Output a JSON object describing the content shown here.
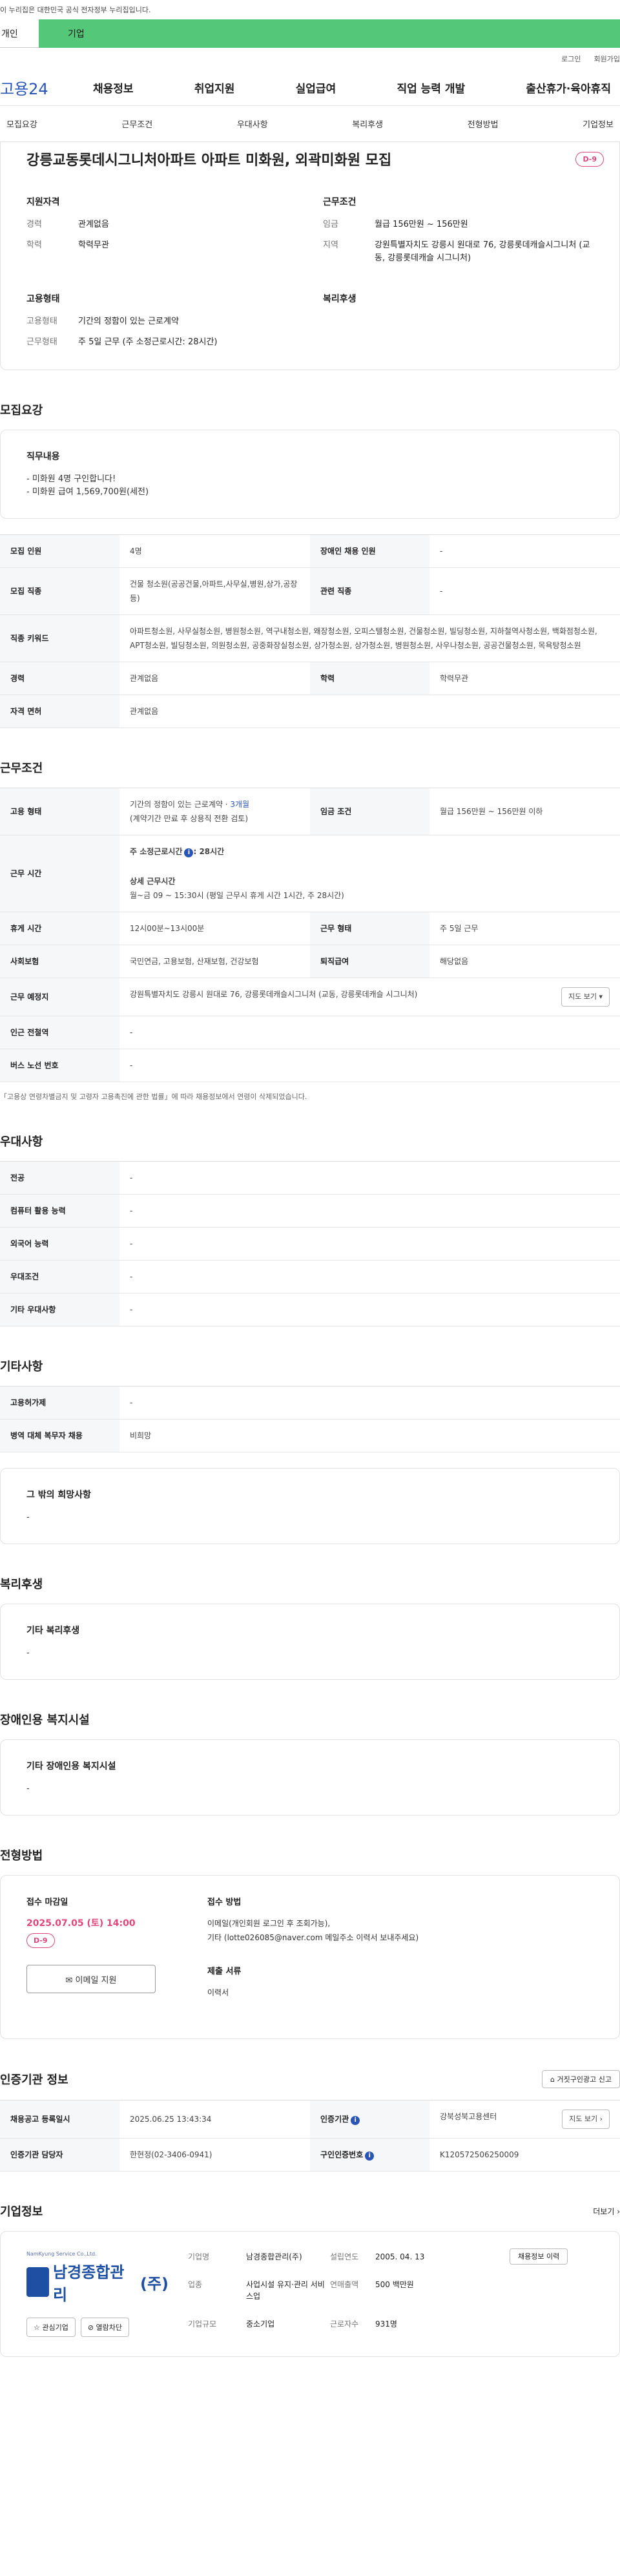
{
  "gov_banner": "이 누리집은 대한민국 공식 전자정부 누리집입니다.",
  "seg": {
    "personal": "개인",
    "company": "기업"
  },
  "util": {
    "login": "로그인",
    "join": "회원가입"
  },
  "logo": "고용24",
  "gnb": [
    "채용정보",
    "취업지원",
    "실업급여",
    "직업 능력 개발",
    "출산휴가·육아휴직"
  ],
  "tabs": [
    "모집요강",
    "근무조건",
    "우대사항",
    "복리후생",
    "전형방법",
    "기업정보"
  ],
  "title": "강릉교동롯데시그니처아파트 아파트 미화원, 외곽미화원 모집",
  "dday": "D-9",
  "summary": {
    "qual_title": "지원자격",
    "career_k": "경력",
    "career_v": "관계없음",
    "edu_k": "학력",
    "edu_v": "학력무관",
    "cond_title": "근무조건",
    "wage_k": "임금",
    "wage_v": "월급 156만원 ~ 156만원",
    "region_k": "지역",
    "region_v": "강원특별자치도 강릉시 원대로 76, 강릉롯데캐슬시그니처 (교동, 강릉롯데캐슬 시그니처)",
    "emp_title": "고용형태",
    "type_k": "고용형태",
    "type_v": "기간의 정함이 있는 근로계약",
    "hours_k": "근무형태",
    "hours_v": "주 5일 근무 (주 소정근로시간: 28시간)",
    "welfare_title": "복리후생"
  },
  "sec_recruit": "모집요강",
  "duty": {
    "title": "직무내용",
    "lines": [
      "- 미화원 4명 구인합니다!",
      "- 미화원 급여 1,569,700원(세전)"
    ]
  },
  "recruit_table": {
    "count_k": "모집 인원",
    "count_v": "4명",
    "disabled_k": "장애인 채용 인원",
    "disabled_v": "-",
    "job_k": "모집 직종",
    "job_v": "건물 청소원(공공건물,아파트,사무실,병원,상가,공장 등)",
    "related_k": "관련 직종",
    "related_v": "-",
    "kw_k": "직종 키워드",
    "kw_v": "아파트청소원, 사무실청소원, 병원청소원, 역구내청소원, 왜장청소원, 오피스텔청소원, 건물청소원, 빌딩청소원, 지하철역사청소원, 백화점청소원, APT청소원, 빌딩청소원, 의원청소원, 공중화장실청소원, 상가청소원, 상가청소원, 병원청소원, 사우나청소원, 공공건물청소원, 목욕탕청소원",
    "career_k": "경력",
    "career_v": "관계없음",
    "edu_k": "학력",
    "edu_v": "학력무관",
    "license_k": "자격 면허",
    "license_v": "관계없음"
  },
  "sec_cond": "근무조건",
  "cond_table": {
    "type_k": "고용 형태",
    "type_v1": "기간의 정함이 있는 근로계약 · ",
    "type_months": "3개월",
    "type_v2": "(계약기간 만료 후 상용직 전환 검토)",
    "wage_k": "임금 조건",
    "wage_v": "월급 156만원 ~ 156만원 이하",
    "time_k": "근무 시간",
    "time_h1": "주 소정근로시간",
    "time_hours": ": 28시간",
    "time_detail_t": "상세 근무시간",
    "time_detail": "월~금 09 ~ 15:30시 (평일 근무시 휴게 시간 1시간, 주 28시간)",
    "rest_k": "휴게 시간",
    "rest_v": "12시00분~13시00분",
    "form_k": "근무 형태",
    "form_v": "주 5일 근무",
    "ins_k": "사회보험",
    "ins_v": "국민연금, 고용보험, 산재보험, 건강보험",
    "sev_k": "퇴직급여",
    "sev_v": "해당없음",
    "place_k": "근무 예정지",
    "place_v": "강원특별자치도 강릉시 원대로 76, 강릉롯데캐슬시그니처 (교동, 강릉롯데캐슬 시그니처)",
    "map_btn": "지도 보기 ▾",
    "subway_k": "인근 전철역",
    "subway_v": "-",
    "bus_k": "버스 노선 번호",
    "bus_v": "-"
  },
  "cond_note": "「고용상 연령차별금지 및 고령자 고용촉진에 관한 법률」에 따라 채용정보에서 연령이 삭제되었습니다.",
  "sec_pref": "우대사항",
  "pref_table": [
    {
      "k": "전공",
      "v": "-"
    },
    {
      "k": "컴퓨터 활용 능력",
      "v": "-"
    },
    {
      "k": "외국어 능력",
      "v": "-"
    },
    {
      "k": "우대조건",
      "v": "-"
    },
    {
      "k": "기타 우대사항",
      "v": "-"
    }
  ],
  "sec_etc": "기타사항",
  "etc_table": [
    {
      "k": "고용허가제",
      "v": "-"
    },
    {
      "k": "병역 대체 복무자 채용",
      "v": "비희망"
    }
  ],
  "etc_box": {
    "title": "그 밖의 희망사항",
    "v": "-"
  },
  "sec_welfare": "복리후생",
  "welfare_box": {
    "title": "기타 복리후생",
    "v": "-"
  },
  "sec_disabled": "장애인용 복지시설",
  "disabled_box": {
    "title": "기타 장애인용 복지시설",
    "v": "-"
  },
  "sec_apply": "전형방법",
  "apply": {
    "deadline_t": "접수 마감일",
    "deadline": "2025.07.05 (토) 14:00",
    "dday": "D-9",
    "email_btn": "이메일 지원",
    "method_t": "접수 방법",
    "method_v1": "이메일(개인회원 로그인 후 조회가능),",
    "method_v2": "기타 (lotte026085@naver.com 메일주소 이력서 보내주세요)",
    "docs_t": "제출 서류",
    "docs_v": "이력서"
  },
  "sec_agency": "인증기관 정보",
  "report_btn": "거짓구인광고 신고",
  "agency_table": {
    "reg_k": "채용공고 등록일시",
    "reg_v": "2025.06.25 13:43:34",
    "org_k": "인증기관",
    "org_v": "강북성북고용센터",
    "map_btn": "지도 보기 ›",
    "staff_k": "인증기관 담당자",
    "staff_v": "한현정(02-3406-0941)",
    "id_k": "구인인증번호",
    "id_v": "K120572506250009"
  },
  "sec_company": "기업정보",
  "more": "더보기 ›",
  "company": {
    "en": "NamKyung Service Co.,Ltd.",
    "logo_name": "남경종합관리",
    "logo_tag": "(주)",
    "like": "☆ 관심기업",
    "block": "⊘ 열람차단",
    "name_k": "기업명",
    "name_v": "남경종합관리(주)",
    "ind_k": "업종",
    "ind_v": "사업시설 유지·관리 서비스업",
    "size_k": "기업규모",
    "size_v": "중소기업",
    "year_k": "설립연도",
    "year_v": "2005. 04. 13",
    "sales_k": "연매출액",
    "sales_v": "500 백만원",
    "emp_k": "근로자수",
    "emp_v": "931명",
    "view_btn": "채용정보 이력"
  },
  "colors": {
    "accent": "#2a55b8",
    "green": "#54c878",
    "dday": "#e0457b"
  }
}
